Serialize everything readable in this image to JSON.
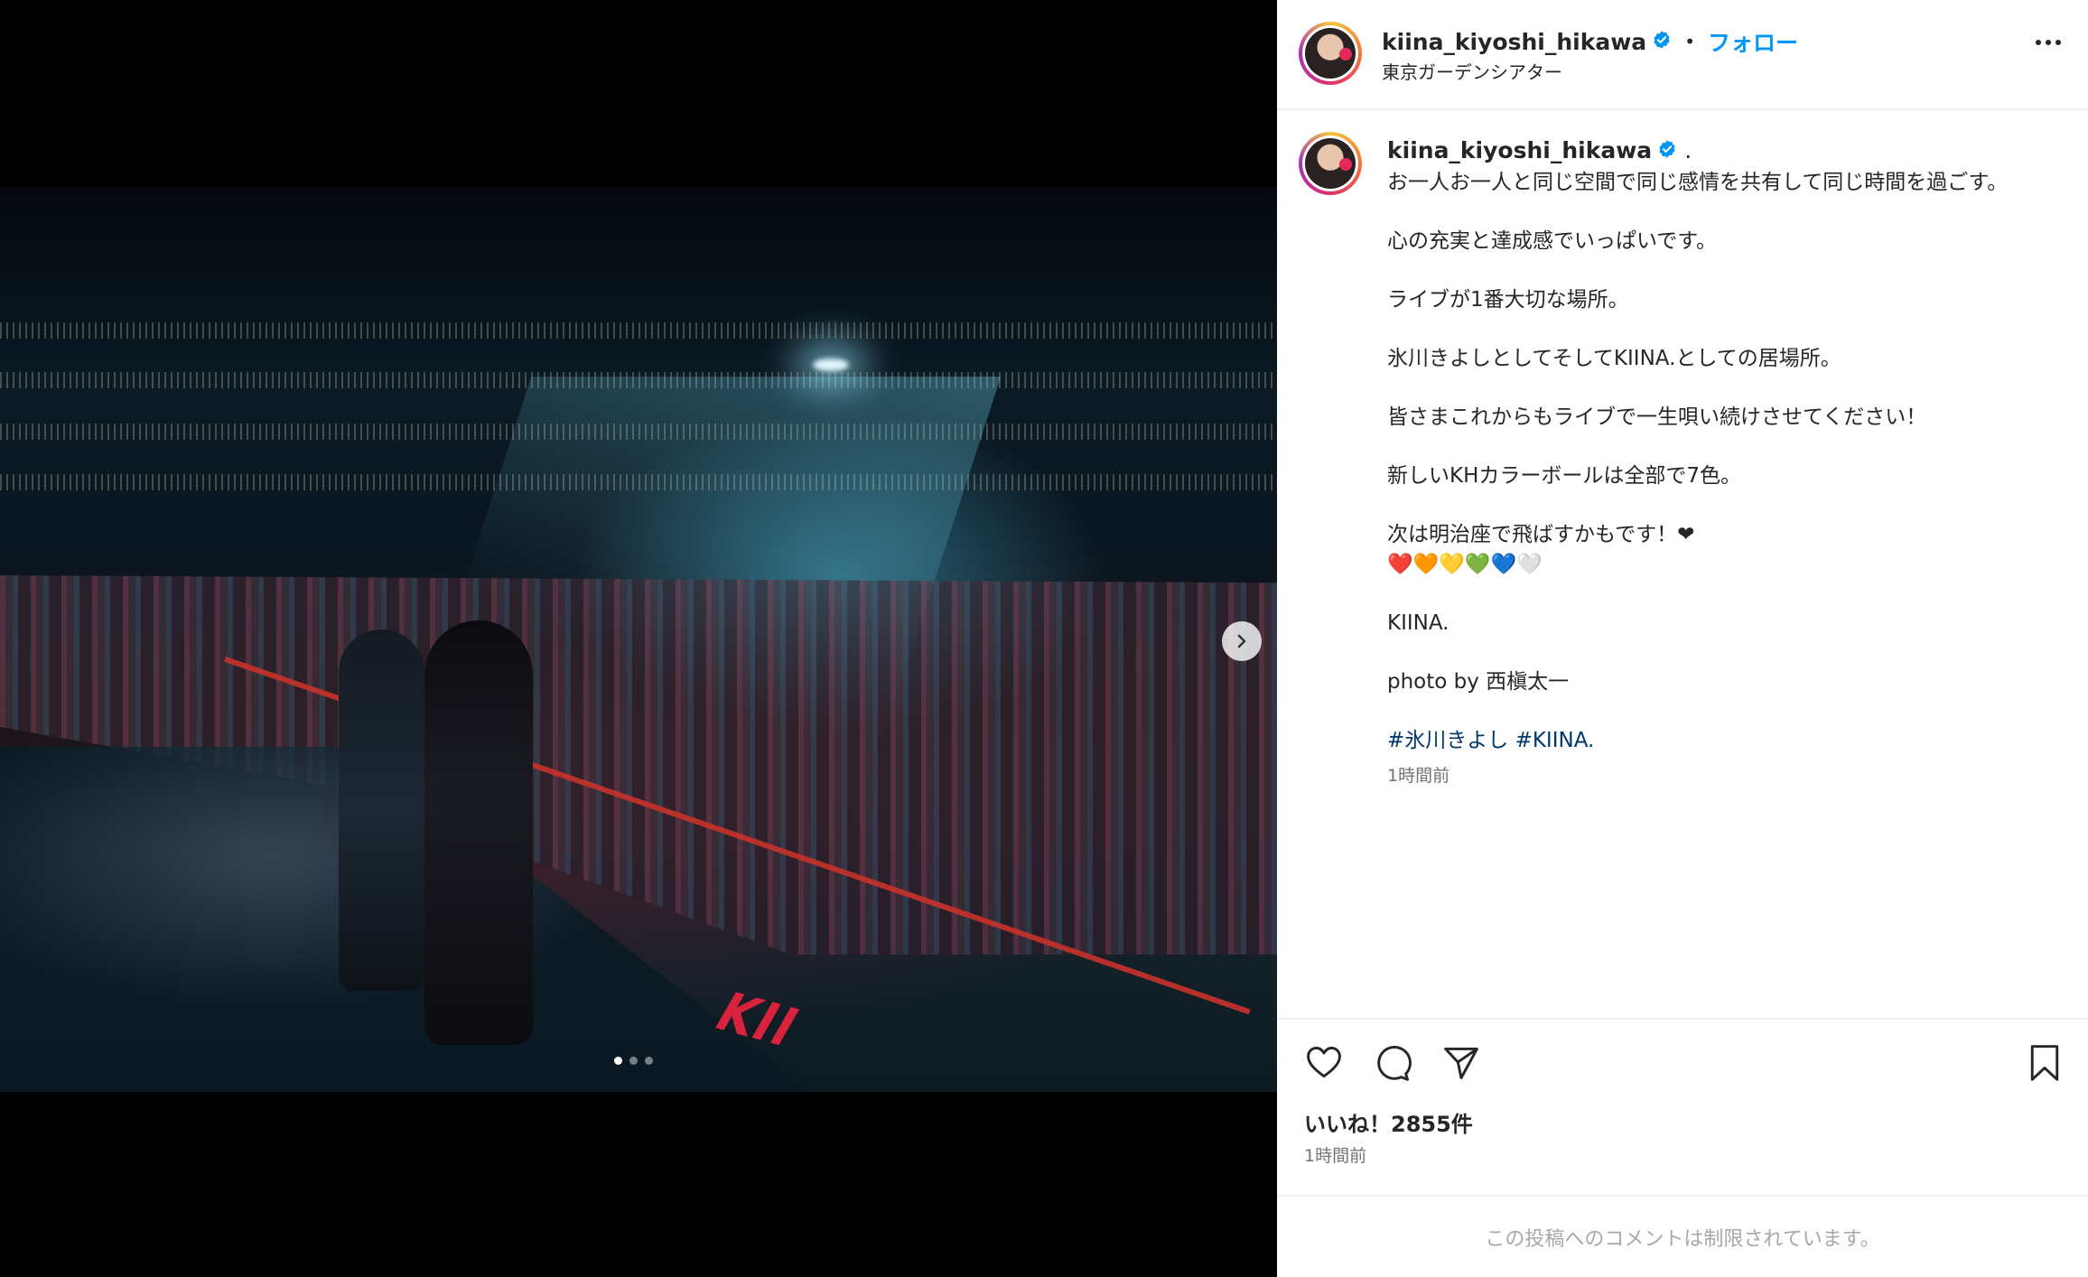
{
  "post": {
    "username": "kiina_kiyoshi_hikawa",
    "follow_label": "フォロー",
    "separator": "•",
    "location": "東京ガーデンシアター",
    "more_label": "…"
  },
  "media": {
    "slide_count": 3,
    "active_slide": 1,
    "stage_sign": "KII"
  },
  "caption": {
    "username": "kiina_kiyoshi_hikawa",
    "lead": ".",
    "lines": [
      "お一人お一人と同じ空間で同じ感情を共有して同じ時間を過ごす。",
      "心の充実と達成感でいっぱいです。",
      "ライブが1番大切な場所。",
      "氷川きよしとしてそしてKIINA.としての居場所。",
      "皆さまこれからもライブで一生唄い続けさせてください！",
      "新しいKHカラーボールは全部で7色。",
      "次は明治座で飛ばすかもです！❤",
      "❤️🧡💛💚💙🤍",
      "KIINA.",
      "photo by 西槇太一"
    ],
    "hashtags": "#氷川きよし #KIINA.",
    "time": "1時間前"
  },
  "actions": {
    "likes": "いいね！2855件",
    "time": "1時間前",
    "comments_restricted": "この投稿へのコメントは制限されています。"
  },
  "colors": {
    "accent": "#0095f6",
    "hashtag": "#00376b",
    "muted": "#737373"
  }
}
